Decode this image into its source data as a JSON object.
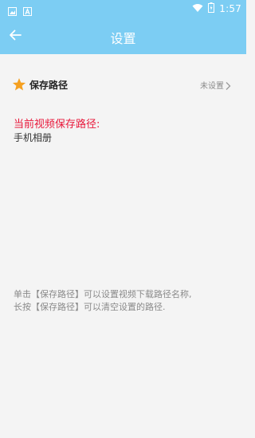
{
  "status_bar": {
    "time": "1:57",
    "icons": [
      "image-notification-icon",
      "a-notification-icon",
      "wifi-icon",
      "battery-icon"
    ]
  },
  "app_bar": {
    "title": "设置",
    "back_icon": "arrow-left-icon"
  },
  "setting_row": {
    "icon": "star-icon",
    "label": "保存路径",
    "value": "未设置",
    "chevron_icon": "chevron-right-icon"
  },
  "current_path": {
    "title": "当前视频保存路径:",
    "value": "手机相册"
  },
  "help": {
    "line1": "单击【保存路径】可以设置视频下载路径名称,",
    "line2": "长按【保存路径】可以清空设置的路径."
  },
  "colors": {
    "accent": "#7ccdf3",
    "title_red": "#e8173a",
    "star_orange": "#f5a020"
  }
}
